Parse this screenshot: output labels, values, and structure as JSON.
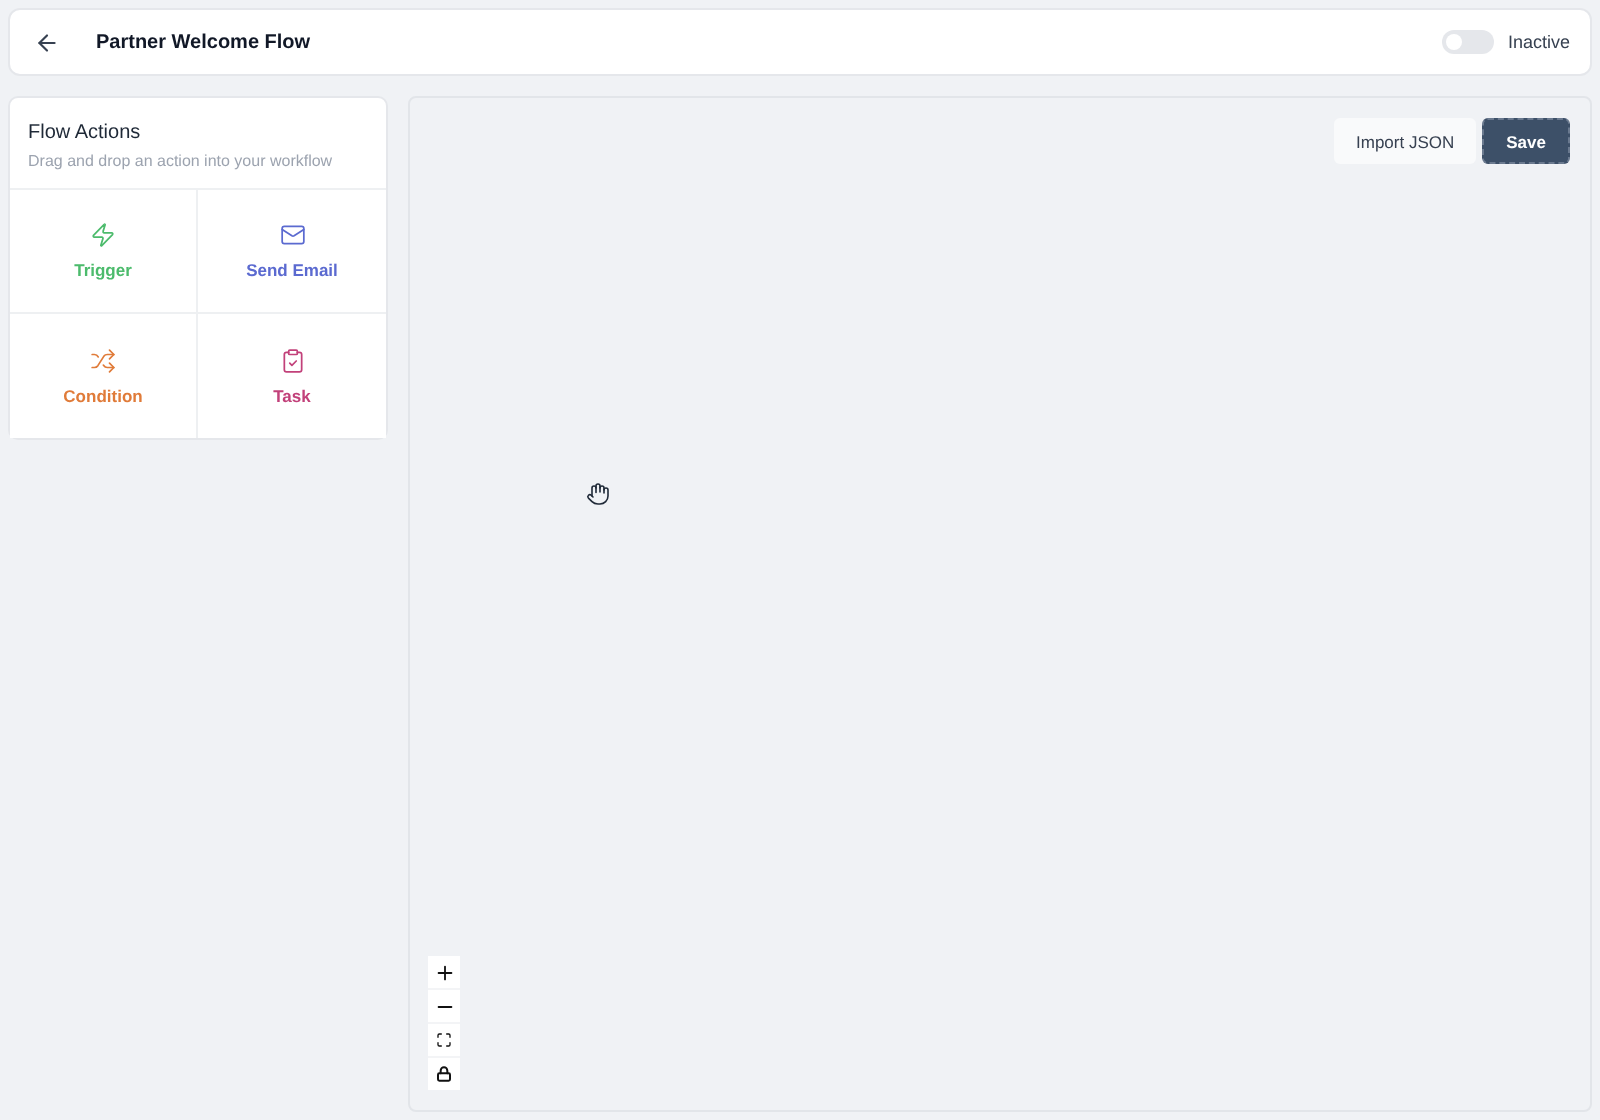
{
  "header": {
    "title": "Partner Welcome Flow",
    "toggle": {
      "on": false,
      "label": "Inactive"
    }
  },
  "sidebar": {
    "title": "Flow Actions",
    "subtitle": "Drag and drop an action into your workflow",
    "actions": [
      {
        "kind": "trigger",
        "label": "Trigger",
        "color": "#4cbb6c"
      },
      {
        "kind": "email",
        "label": "Send Email",
        "color": "#5b6ad0"
      },
      {
        "kind": "condition",
        "label": "Condition",
        "color": "#e07b39"
      },
      {
        "kind": "task",
        "label": "Task",
        "color": "#c2417a"
      }
    ]
  },
  "canvas": {
    "buttons": [
      {
        "kind": "secondary",
        "label": "Import JSON"
      },
      {
        "kind": "primary",
        "label": "Save"
      }
    ],
    "controls": [
      {
        "kind": "zoom-in"
      },
      {
        "kind": "zoom-out"
      },
      {
        "kind": "fit"
      },
      {
        "kind": "lock"
      }
    ]
  }
}
